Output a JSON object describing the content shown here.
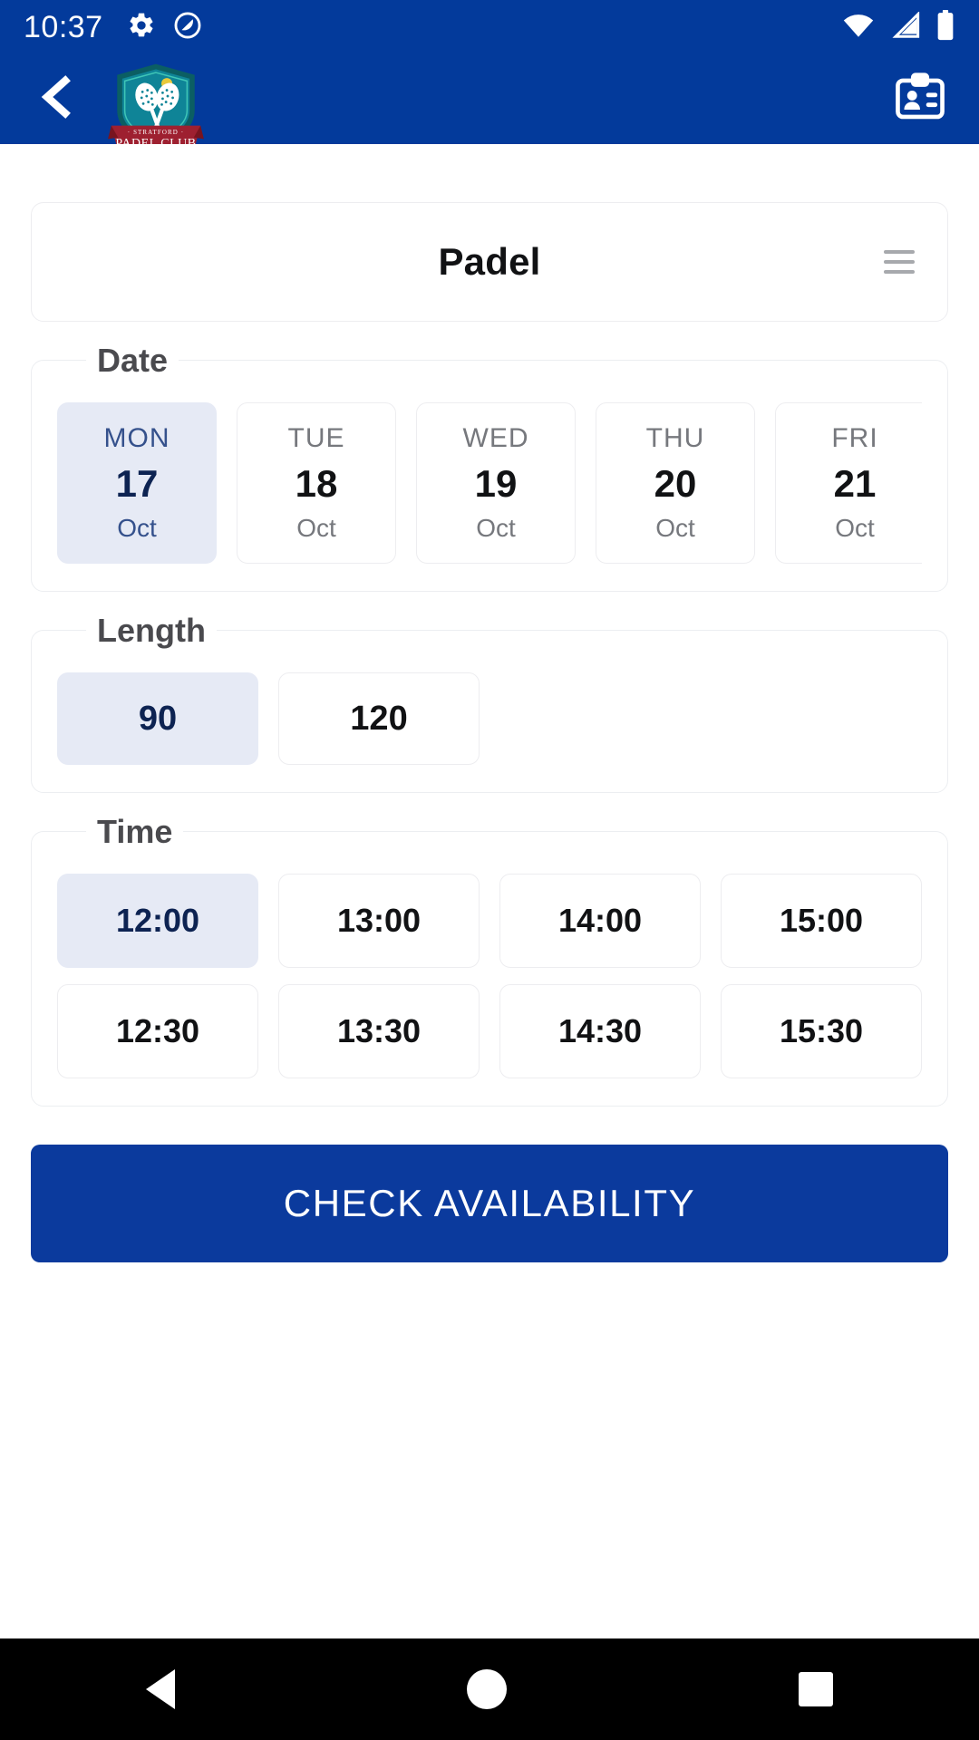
{
  "status_bar": {
    "time": "10:37",
    "icons": [
      "gear-icon",
      "do-not-disturb-icon",
      "wifi-icon",
      "cellular-signal-icon",
      "battery-icon"
    ]
  },
  "app_bar": {
    "back_icon": "back-chevron-icon",
    "logo": {
      "name": "stratford-padel-club-logo",
      "club_top": "· S T R A T F O R D ·",
      "club_name": "PADEL CLUB",
      "shield_color": "#0F8497",
      "shield_border": "#0B5E63",
      "ribbon_color": "#9E2030",
      "ball_color": "#E8C93B"
    },
    "badge_icon": "contact-badge-icon"
  },
  "sport_card": {
    "title": "Padel",
    "menu_icon": "hamburger-menu-icon"
  },
  "date_section": {
    "legend": "Date",
    "options": [
      {
        "dow": "MON",
        "day": "17",
        "month": "Oct",
        "selected": true
      },
      {
        "dow": "TUE",
        "day": "18",
        "month": "Oct",
        "selected": false
      },
      {
        "dow": "WED",
        "day": "19",
        "month": "Oct",
        "selected": false
      },
      {
        "dow": "THU",
        "day": "20",
        "month": "Oct",
        "selected": false
      },
      {
        "dow": "FRI",
        "day": "21",
        "month": "Oct",
        "selected": false
      }
    ]
  },
  "length_section": {
    "legend": "Length",
    "options": [
      {
        "label": "90",
        "selected": true
      },
      {
        "label": "120",
        "selected": false
      }
    ]
  },
  "time_section": {
    "legend": "Time",
    "row1": [
      {
        "label": "12:00",
        "selected": true
      },
      {
        "label": "13:00",
        "selected": false
      },
      {
        "label": "14:00",
        "selected": false
      },
      {
        "label": "15:00",
        "selected": false
      }
    ],
    "row2": [
      {
        "label": "12:30",
        "selected": false
      },
      {
        "label": "13:30",
        "selected": false
      },
      {
        "label": "14:30",
        "selected": false
      },
      {
        "label": "15:30",
        "selected": false
      }
    ]
  },
  "cta": {
    "label": "CHECK AVAILABILITY"
  },
  "nav_bar": {
    "back": "nav-back-triangle-icon",
    "home": "nav-home-circle-icon",
    "recents": "nav-recents-square-icon"
  },
  "colors": {
    "brand_navy": "#033A9B",
    "cta_navy": "#0B3A9D",
    "selected_chip_bg": "#E6EAF5",
    "selected_text": "#0D2352"
  }
}
